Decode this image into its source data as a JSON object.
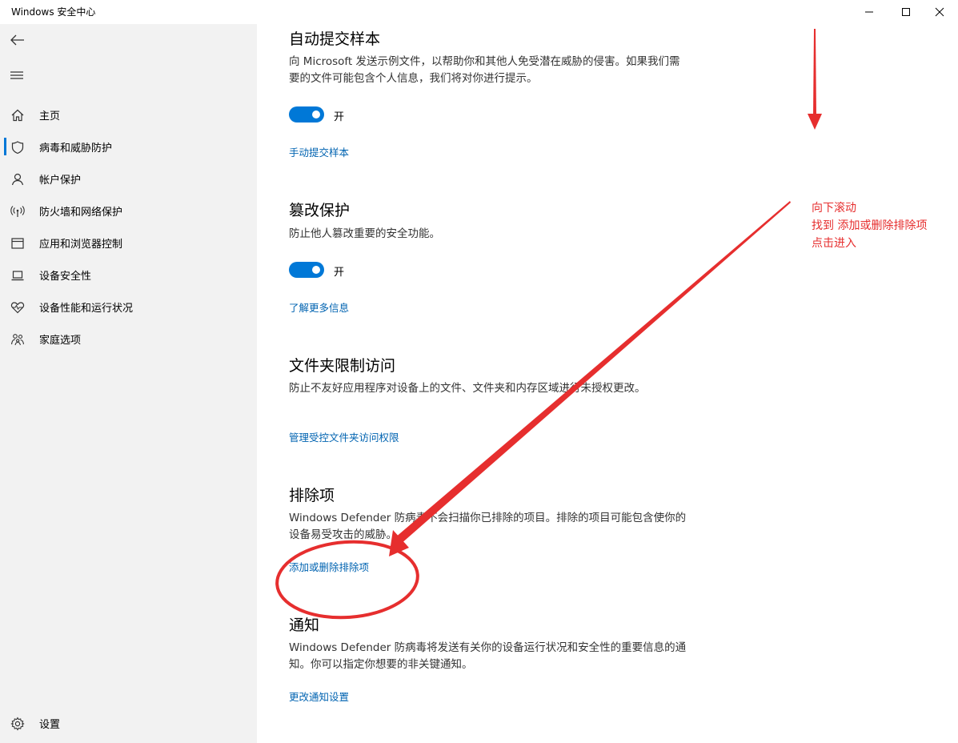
{
  "window": {
    "title": "Windows 安全中心"
  },
  "sidebar": {
    "items": [
      {
        "label": "主页",
        "icon": "home-icon"
      },
      {
        "label": "病毒和威胁防护",
        "icon": "shield-icon"
      },
      {
        "label": "帐户保护",
        "icon": "person-icon"
      },
      {
        "label": "防火墙和网络保护",
        "icon": "wifi-signal-icon"
      },
      {
        "label": "应用和浏览器控制",
        "icon": "app-window-icon"
      },
      {
        "label": "设备安全性",
        "icon": "laptop-icon"
      },
      {
        "label": "设备性能和运行状况",
        "icon": "heart-pulse-icon"
      },
      {
        "label": "家庭选项",
        "icon": "family-icon"
      }
    ],
    "active_index": 1,
    "settings_label": "设置"
  },
  "main": {
    "sample": {
      "title": "自动提交样本",
      "desc": "向 Microsoft 发送示例文件，以帮助你和其他人免受潜在威胁的侵害。如果我们需要的文件可能包含个人信息，我们将对你进行提示。",
      "toggle_state": "开",
      "link": "手动提交样本"
    },
    "tamper": {
      "title": "篡改保护",
      "desc": "防止他人篡改重要的安全功能。",
      "toggle_state": "开",
      "link": "了解更多信息"
    },
    "folder": {
      "title": "文件夹限制访问",
      "desc": "防止不友好应用程序对设备上的文件、文件夹和内存区域进行未授权更改。",
      "link": "管理受控文件夹访问权限"
    },
    "exclusions": {
      "title": "排除项",
      "desc": "Windows Defender 防病毒不会扫描你已排除的项目。排除的项目可能包含使你的设备易受攻击的威胁。",
      "link": "添加或删除排除项"
    },
    "notifications": {
      "title": "通知",
      "desc": "Windows Defender 防病毒将发送有关你的设备运行状况和安全性的重要信息的通知。你可以指定你想要的非关键通知。",
      "link": "更改通知设置"
    }
  },
  "annotation": {
    "line1": "向下滚动",
    "line2": "找到 添加或删除排除项",
    "line3": "点击进入",
    "color": "#e62e2e"
  },
  "colors": {
    "accent": "#0078d7",
    "link": "#0063b1",
    "sidebar_bg": "#f2f2f2"
  }
}
